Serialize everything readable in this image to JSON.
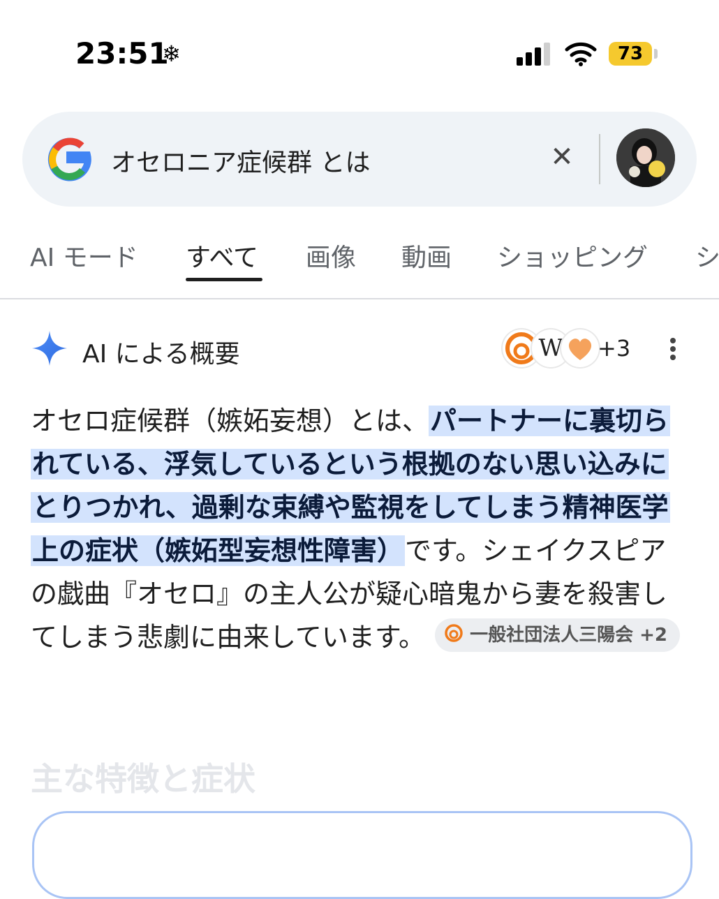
{
  "status_bar": {
    "time": "23:51",
    "time_icon": "snowflake-icon",
    "battery": "73",
    "battery_color": "#f5c92e"
  },
  "search": {
    "query": "オセロニア症候群 とは",
    "clear_icon": "close-icon",
    "avatar": "profile-avatar"
  },
  "tabs": [
    {
      "label": "AI モード"
    },
    {
      "label": "すべて"
    },
    {
      "label": "画像"
    },
    {
      "label": "動画"
    },
    {
      "label": "ショッピング"
    },
    {
      "label": "シ"
    }
  ],
  "ai_overview": {
    "title": "AI による概要",
    "sources_more": "+3",
    "text_before": "オセロ症候群（嫉妬妄想）とは、",
    "text_highlight": "パートナーに裏切られている、浮気しているという根拠のない思い込みにとりつかれ、過剰な束縛や監視をしてしまう精神医学上の症状（嫉妬型妄想性障害）",
    "text_after": "です。シェイクスピアの戯曲『オセロ』の主人公が疑心暗鬼から妻を殺害してしまう悲劇に由来しています。",
    "source_chip": "一般社団法人三陽会 +2",
    "section_title": "主な特徴と症状",
    "highlight_color": "#d3e3fd"
  }
}
